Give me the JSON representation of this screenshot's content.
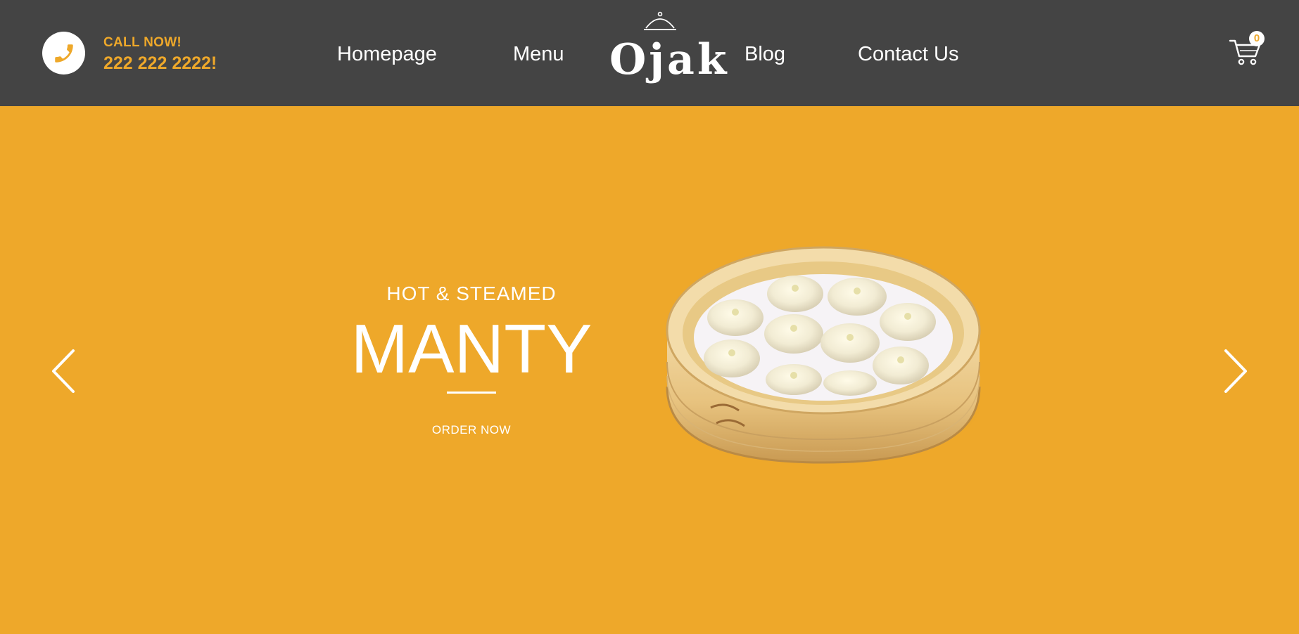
{
  "header": {
    "call_label": "CALL NOW!",
    "call_number": "222 222 2222!",
    "nav": {
      "homepage": "Homepage",
      "menu": "Menu",
      "blog": "Blog",
      "contact": "Contact Us"
    },
    "logo_text": "Ojak",
    "cart_count": "0"
  },
  "hero": {
    "subtitle": "HOT & STEAMED",
    "title": "MANTY",
    "cta": "ORDER NOW"
  },
  "colors": {
    "accent": "#EEA82A",
    "header_bg": "#444444",
    "text_light": "#ffffff"
  },
  "icons": {
    "phone": "phone-icon",
    "cart": "cart-icon",
    "cloche": "cloche-icon",
    "prev": "chevron-left-icon",
    "next": "chevron-right-icon"
  }
}
